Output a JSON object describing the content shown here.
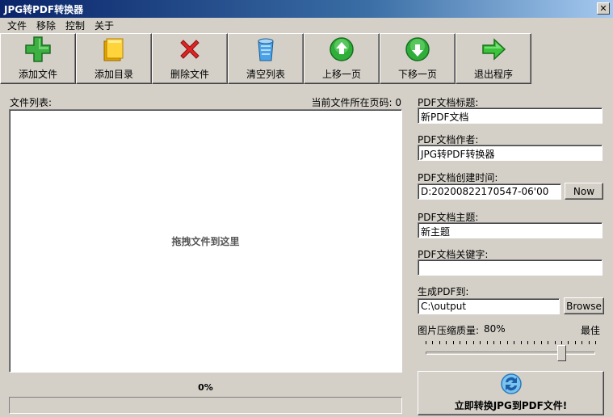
{
  "window": {
    "title": "JPG转PDF转换器",
    "close_label": "✕"
  },
  "menu": [
    "文件",
    "移除",
    "控制",
    "关于"
  ],
  "toolbar": [
    {
      "label": "添加文件",
      "icon": "add-file-icon"
    },
    {
      "label": "添加目录",
      "icon": "folder-icon"
    },
    {
      "label": "删除文件",
      "icon": "delete-icon"
    },
    {
      "label": "清空列表",
      "icon": "clear-list-icon"
    },
    {
      "label": "上移一页",
      "icon": "arrow-up-icon"
    },
    {
      "label": "下移一页",
      "icon": "arrow-down-icon"
    },
    {
      "label": "退出程序",
      "icon": "exit-arrow-icon"
    }
  ],
  "filelist": {
    "label": "文件列表:",
    "current_page_label": "当前文件所在页码: 0",
    "drop_hint": "拖拽文件到这里"
  },
  "progress": {
    "text": "0%",
    "fraction": 0
  },
  "pdf": {
    "title_label": "PDF文档标题:",
    "title_value": "新PDF文档",
    "author_label": "PDF文档作者:",
    "author_value": "JPG转PDF转换器",
    "created_label": "PDF文档创建时间:",
    "created_value": "D:20200822170547-06'00",
    "now_label": "Now",
    "subject_label": "PDF文档主题:",
    "subject_value": "新主题",
    "keywords_label": "PDF文档关键字:",
    "keywords_value": "",
    "output_label": "生成PDF到:",
    "output_value": "C:\\output",
    "browse_label": "Browse"
  },
  "quality": {
    "label": "图片压缩质量:",
    "value_text": "80%",
    "best_label": "最佳",
    "fraction": 0.8
  },
  "convert": {
    "label": "立即转换JPG到PDF文件!",
    "icon": "convert-refresh-icon"
  },
  "colors": {
    "titlebar": "#0a246a",
    "face": "#d4d0c8"
  }
}
